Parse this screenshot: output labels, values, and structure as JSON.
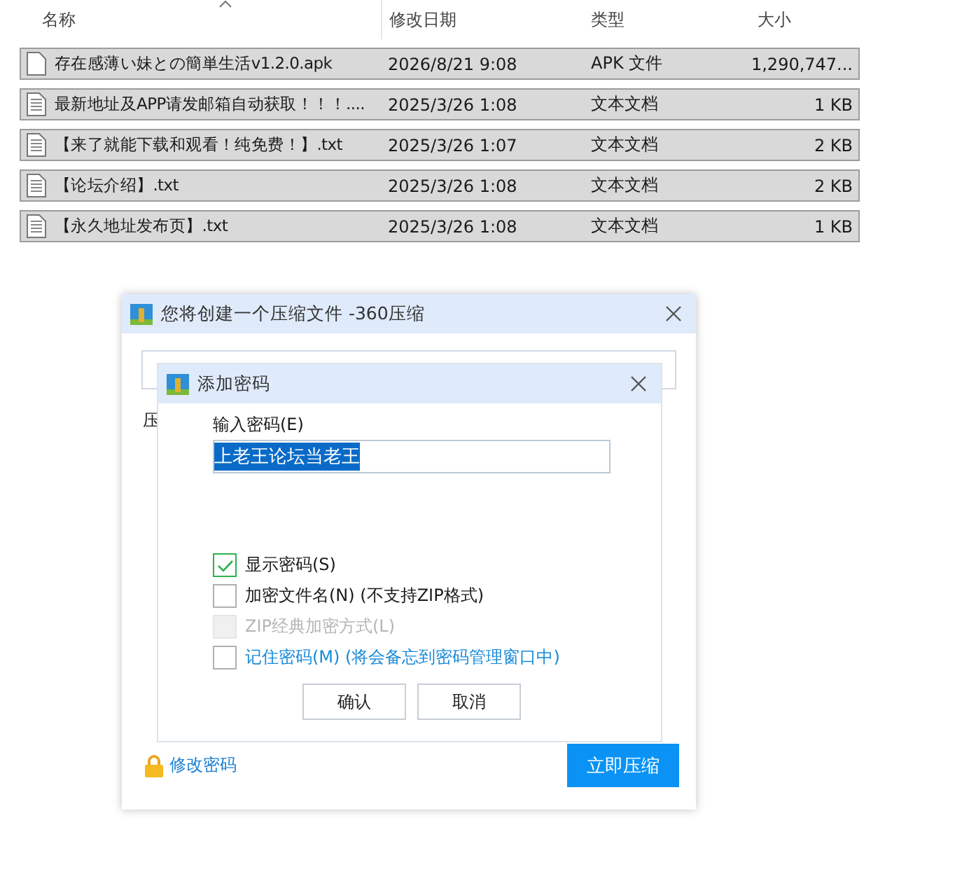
{
  "file_list": {
    "columns": [
      "名称",
      "修改日期",
      "类型",
      "大小"
    ],
    "rows": [
      {
        "kind": "blank",
        "name": "存在感薄い妹との簡単生活v1.2.0.apk",
        "date": "2026/8/21 9:08",
        "type": "APK 文件",
        "size": "1,290,747..."
      },
      {
        "kind": "text",
        "name": "最新地址及APP请发邮箱自动获取！！！....",
        "date": "2025/3/26 1:08",
        "type": "文本文档",
        "size": "1 KB"
      },
      {
        "kind": "text",
        "name": "【来了就能下载和观看！纯免费！】.txt",
        "date": "2025/3/26 1:07",
        "type": "文本文档",
        "size": "2 KB"
      },
      {
        "kind": "text",
        "name": "【论坛介绍】.txt",
        "date": "2025/3/26 1:08",
        "type": "文本文档",
        "size": "2 KB"
      },
      {
        "kind": "text",
        "name": "【永久地址发布页】.txt",
        "date": "2025/3/26 1:08",
        "type": "文本文档",
        "size": "1 KB"
      }
    ]
  },
  "compress_dialog": {
    "title": "您将创建一个压缩文件 -360压缩",
    "side_label": "压",
    "password_link": "修改密码",
    "compress_button": "立即压缩"
  },
  "password_dialog": {
    "title": "添加密码",
    "password_label": "输入密码(E)",
    "password_value": "上老王论坛当老王",
    "options": [
      {
        "kind": "check",
        "label": "显示密码(S)",
        "checked": true,
        "disabled": false
      },
      {
        "kind": "check",
        "label": "加密文件名(N) (不支持ZIP格式)",
        "checked": false,
        "disabled": false
      },
      {
        "kind": "check",
        "label": "ZIP经典加密方式(L)",
        "checked": false,
        "disabled": true
      },
      {
        "kind": "link",
        "label": "记住密码(M) (将会备忘到密码管理窗口中)",
        "checked": false,
        "disabled": false
      }
    ],
    "buttons": [
      "确认",
      "取消"
    ]
  }
}
